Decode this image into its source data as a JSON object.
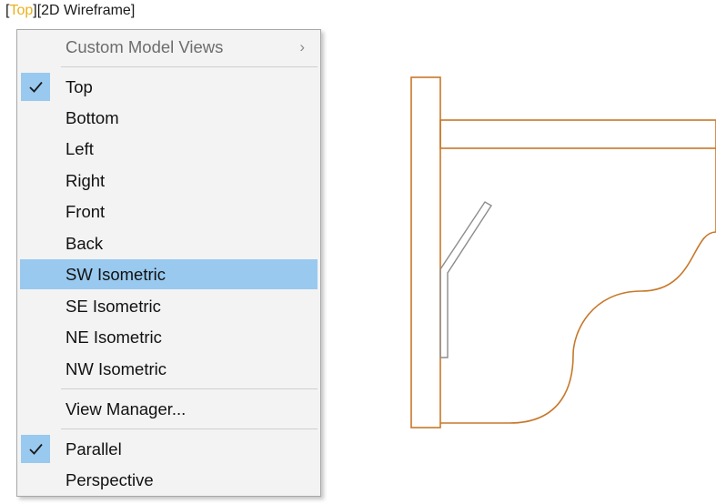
{
  "viewport": {
    "open_bracket": "[",
    "view": "Top",
    "close_bracket": "]",
    "visual_style": "[2D Wireframe]"
  },
  "menu": {
    "custom_views": {
      "label": "Custom Model Views",
      "arrow": "›"
    },
    "views": [
      {
        "label": "Top",
        "checked": true
      },
      {
        "label": "Bottom"
      },
      {
        "label": "Left"
      },
      {
        "label": "Right"
      },
      {
        "label": "Front"
      },
      {
        "label": "Back"
      },
      {
        "label": "SW Isometric",
        "highlighted": true
      },
      {
        "label": "SE Isometric"
      },
      {
        "label": "NE Isometric"
      },
      {
        "label": "NW Isometric"
      }
    ],
    "view_manager": {
      "label": "View Manager..."
    },
    "projection": [
      {
        "label": "Parallel",
        "checked": true
      },
      {
        "label": "Perspective"
      }
    ]
  },
  "colors": {
    "view_name": "#e8b11c",
    "highlight": "#99c9ef",
    "drawing_line": "#c7782a",
    "drawing_gray": "#8c8c8c"
  },
  "icons": [
    "checkmark-icon",
    "chevron-right-icon"
  ]
}
